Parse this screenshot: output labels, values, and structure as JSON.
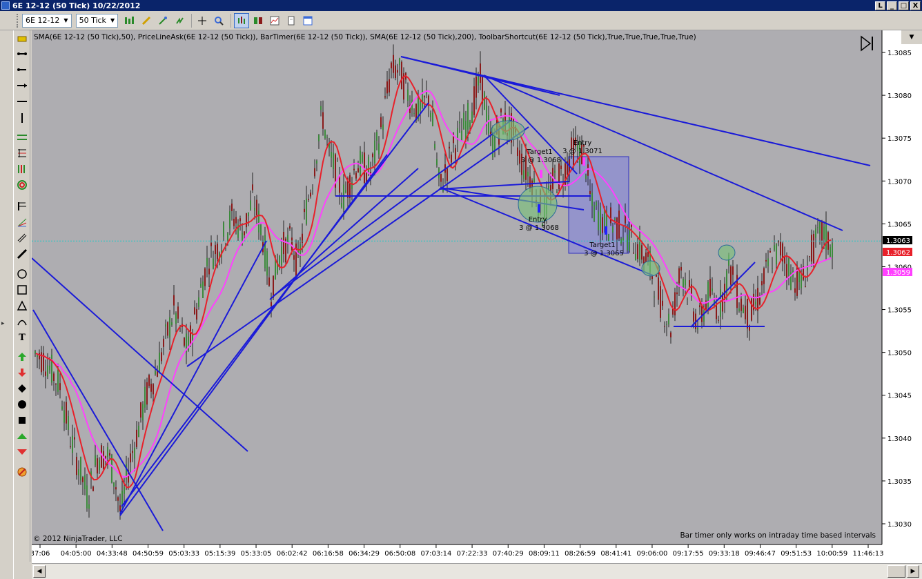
{
  "window": {
    "title": "6E 12-12 (50 Tick)  10/22/2012",
    "minimize": "_",
    "restore": "□",
    "close": "X",
    "extra": "L"
  },
  "toolbar": {
    "instrument": "6E 12-12",
    "interval": "50 Tick"
  },
  "chart": {
    "indicator_label": "SMA(6E 12-12 (50 Tick),50), PriceLineAsk(6E 12-12 (50 Tick)), BarTimer(6E 12-12 (50 Tick)), SMA(6E 12-12 (50 Tick),200), ToolbarShortcut(6E 12-12 (50 Tick),True,True,True,True,True)",
    "copyright": "© 2012 NinjaTrader, LLC",
    "bar_timer_message": "Bar timer only works on intraday time based intervals",
    "price_ticks": [
      "1.3085",
      "1.3080",
      "1.3075",
      "1.3070",
      "1.3065",
      "1.3060",
      "1.3055",
      "1.3050",
      "1.3045",
      "1.3040",
      "1.3035",
      "1.3030"
    ],
    "time_ticks": [
      "37:06",
      "04:05:00",
      "04:33:48",
      "04:50:59",
      "05:03:33",
      "05:15:39",
      "05:33:05",
      "06:02:42",
      "06:16:58",
      "06:34:29",
      "06:50:08",
      "07:03:14",
      "07:22:33",
      "07:40:29",
      "08:09:11",
      "08:26:59",
      "08:41:41",
      "09:06:00",
      "09:17:55",
      "09:33:18",
      "09:46:47",
      "09:51:53",
      "10:00:59",
      "11:46:13"
    ],
    "price_markers": [
      {
        "value": "1.3063",
        "color": "#000000",
        "text_color": "#ffffff"
      },
      {
        "value": "1.3062",
        "color": "#e8202a",
        "text_color": "#ffffff"
      },
      {
        "value": "1.3059",
        "color": "#ff40ff",
        "text_color": "#ffffff"
      }
    ],
    "annotations": {
      "entry_long": "Entry",
      "entry_long_qty": "3 @ 1.3068",
      "target_long": "Target1",
      "target_long_qty": "3 @ 1.3068",
      "entry_short": "Entry",
      "entry_short_qty": "3 @ 1.3071",
      "target_short": "Target1",
      "target_short_qty": "3 @ 1.3065"
    },
    "colors": {
      "background": "#aeadb1",
      "sma50": "#e8202a",
      "sma200": "#ff40ff",
      "trendline": "#1a1ad8",
      "ask_line": "#20c8c8",
      "bull_bar": "#3c8a3c",
      "bear_bar": "#8a1a1a"
    }
  }
}
